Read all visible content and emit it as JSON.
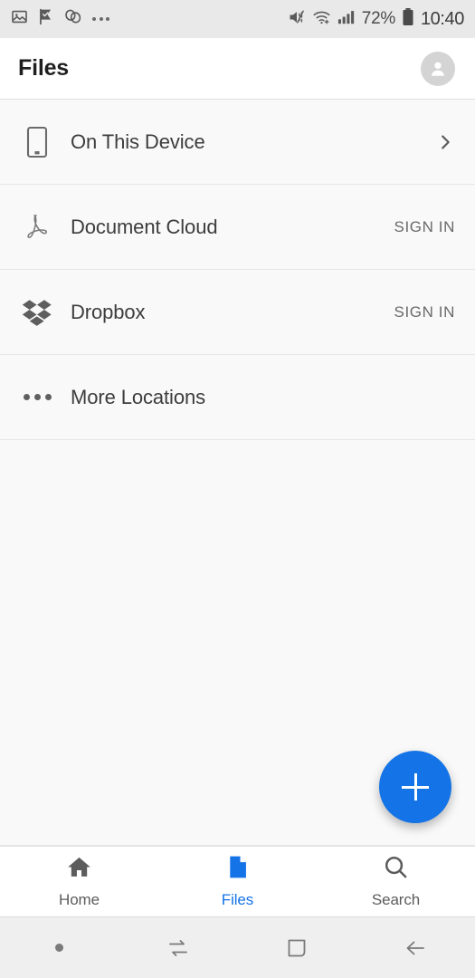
{
  "status_bar": {
    "left_icons": [
      "image-icon",
      "flag-check-icon",
      "link-icon",
      "overflow-dots-icon"
    ],
    "mute_icon": "volume-mute-icon",
    "wifi_icon": "wifi-icon",
    "signal_icon": "cellular-signal-icon",
    "battery_percent": "72%",
    "battery_icon": "battery-icon",
    "clock": "10:40"
  },
  "app_bar": {
    "title": "Files",
    "avatar_icon": "account-avatar-icon"
  },
  "locations": [
    {
      "label": "On This Device",
      "icon": "phone-device-icon",
      "action_type": "chevron",
      "action_label": ""
    },
    {
      "label": "Document Cloud",
      "icon": "adobe-acrobat-icon",
      "action_type": "signin",
      "action_label": "SIGN IN"
    },
    {
      "label": "Dropbox",
      "icon": "dropbox-icon",
      "action_type": "signin",
      "action_label": "SIGN IN"
    },
    {
      "label": "More Locations",
      "icon": "ellipsis-icon",
      "action_type": "none",
      "action_label": ""
    }
  ],
  "fab": {
    "label": "+",
    "icon": "plus-icon",
    "color": "#1473e6"
  },
  "bottom_nav": {
    "active": "Files",
    "active_color": "#1473e6",
    "inactive_color": "#5c5c5c",
    "items": [
      {
        "label": "Home",
        "icon": "home-icon"
      },
      {
        "label": "Files",
        "icon": "file-document-icon"
      },
      {
        "label": "Search",
        "icon": "search-icon"
      }
    ]
  },
  "system_nav": {
    "items": [
      "dot-indicator-icon",
      "recents-icon",
      "home-square-icon",
      "back-arrow-icon"
    ]
  }
}
